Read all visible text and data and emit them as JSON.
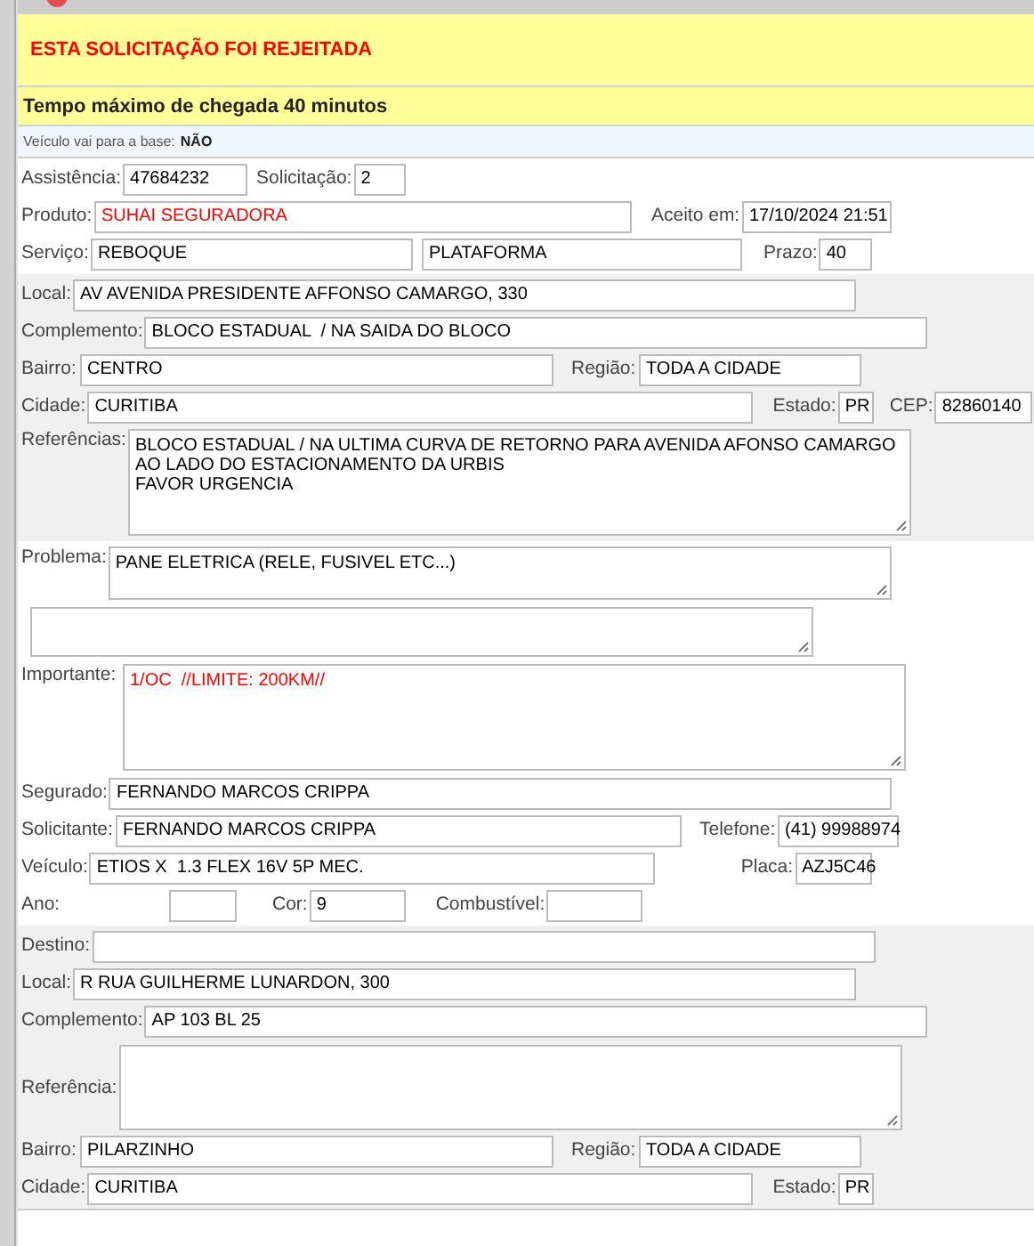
{
  "alerts": [
    {
      "kind": "rejected",
      "text": "ESTA SOLICITAÇÃO FOI REJEITADA"
    },
    {
      "kind": "deadline",
      "text": "Tempo máximo de chegada 40 minutos"
    }
  ],
  "base_notice": {
    "label": "Veículo vai para a base:",
    "value": "NÃO"
  },
  "sections": [
    {
      "kind": "plain",
      "rows": [
        {
          "fields": [
            {
              "kind": "text",
              "label": "Assistência:",
              "value": "47684232"
            },
            {
              "kind": "text",
              "label": "Solicitação:",
              "value": "2"
            }
          ]
        },
        {
          "fields": [
            {
              "kind": "text",
              "label": "Produto:",
              "value": "SUHAI SEGURADORA",
              "highlight": true
            },
            {
              "kind": "text",
              "label": "Aceito em:",
              "value": "17/10/2024 21:51"
            }
          ]
        },
        {
          "fields": [
            {
              "kind": "text",
              "label": "Serviço:",
              "value": "REBOQUE"
            },
            {
              "kind": "text",
              "value": "PLATAFORMA"
            },
            {
              "kind": "text",
              "label": "Prazo:",
              "value": "40"
            }
          ]
        }
      ]
    },
    {
      "kind": "shaded",
      "rows": [
        {
          "fields": [
            {
              "kind": "text",
              "label": "Local:",
              "value": "AV AVENIDA PRESIDENTE AFFONSO CAMARGO, 330"
            }
          ]
        },
        {
          "fields": [
            {
              "kind": "text",
              "label": "Complemento:",
              "value": "BLOCO ESTADUAL  / NA SAIDA DO BLOCO"
            }
          ]
        },
        {
          "fields": [
            {
              "kind": "text",
              "label": "Bairro:",
              "value": "CENTRO"
            },
            {
              "kind": "text",
              "label": "Região:",
              "value": "TODA A CIDADE"
            }
          ]
        },
        {
          "fields": [
            {
              "kind": "text",
              "label": "Cidade:",
              "value": "CURITIBA"
            },
            {
              "kind": "text",
              "label": "Estado:",
              "value": "PR"
            },
            {
              "kind": "text",
              "label": "CEP:",
              "value": "82860140"
            }
          ]
        },
        {
          "fields": [
            {
              "kind": "area",
              "label": "Referências:",
              "value": "BLOCO ESTADUAL / NA ULTIMA CURVA DE RETORNO PARA AVENIDA AFONSO CAMARGO\nAO LADO DO ESTACIONAMENTO DA URBIS\nFAVOR URGENCIA"
            }
          ]
        }
      ]
    },
    {
      "kind": "plain",
      "rows": [
        {
          "fields": [
            {
              "kind": "area",
              "label": "Problema:",
              "value": "PANE ELETRICA (RELE, FUSIVEL ETC...)"
            }
          ]
        },
        {
          "fields": [
            {
              "kind": "area"
            }
          ]
        },
        {
          "fields": [
            {
              "kind": "area",
              "label": "Importante:",
              "value": "1/OC  //LIMITE: 200KM//",
              "highlight": true
            }
          ]
        },
        {
          "fields": [
            {
              "kind": "text",
              "label": "Segurado:",
              "value": "FERNANDO MARCOS CRIPPA"
            }
          ]
        },
        {
          "fields": [
            {
              "kind": "text",
              "label": "Solicitante:",
              "value": "FERNANDO MARCOS CRIPPA"
            },
            {
              "kind": "text",
              "label": "Telefone:",
              "value": "(41) 99988974"
            }
          ]
        },
        {
          "fields": [
            {
              "kind": "text",
              "label": "Veículo:",
              "value": "ETIOS X  1.3 FLEX 16V 5P MEC."
            },
            {
              "kind": "text",
              "label": "Placa:",
              "value": "AZJ5C46"
            }
          ]
        },
        {
          "fields": [
            {
              "kind": "text",
              "label": "Ano:"
            },
            {
              "kind": "text",
              "label": "Cor:",
              "value": "9"
            },
            {
              "kind": "text",
              "label": "Combustível:"
            }
          ]
        }
      ]
    },
    {
      "kind": "shaded",
      "rows": [
        {
          "fields": [
            {
              "kind": "text",
              "label": "Destino:"
            }
          ]
        },
        {
          "fields": [
            {
              "kind": "text",
              "label": "Local:",
              "value": "R RUA GUILHERME LUNARDON, 300"
            }
          ]
        },
        {
          "fields": [
            {
              "kind": "text",
              "label": "Complemento:",
              "value": "AP 103 BL 25"
            }
          ]
        },
        {
          "fields": [
            {
              "kind": "area",
              "label": "Referência:"
            }
          ]
        },
        {
          "fields": [
            {
              "kind": "text",
              "label": "Bairro:",
              "value": "PILARZINHO"
            },
            {
              "kind": "text",
              "label": "Região:",
              "value": "TODA A CIDADE"
            }
          ]
        },
        {
          "fields": [
            {
              "kind": "text",
              "label": "Cidade:",
              "value": "CURITIBA"
            },
            {
              "kind": "text",
              "label": "Estado:",
              "value": "PR"
            }
          ]
        }
      ]
    }
  ]
}
